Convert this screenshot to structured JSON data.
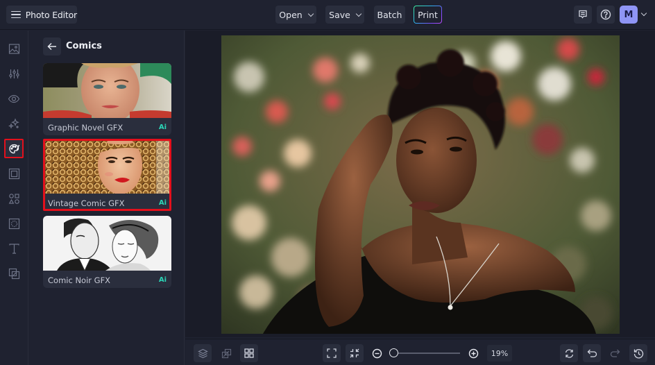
{
  "app": {
    "title": "Photo Editor"
  },
  "toolbar": {
    "open_label": "Open",
    "save_label": "Save",
    "batch_label": "Batch",
    "print_label": "Print",
    "feedback_icon": "feedback-icon",
    "help_icon": "help-icon",
    "avatar_initial": "M"
  },
  "rail": {
    "items": [
      {
        "name": "image",
        "icon": "image-icon",
        "active": false
      },
      {
        "name": "adjust",
        "icon": "sliders-icon",
        "active": false
      },
      {
        "name": "view",
        "icon": "eye-icon",
        "active": false
      },
      {
        "name": "effects",
        "icon": "sparkles-icon",
        "active": false
      },
      {
        "name": "artsy",
        "icon": "palette-icon",
        "active": true
      },
      {
        "name": "frames",
        "icon": "frame-icon",
        "active": false
      },
      {
        "name": "graphics",
        "icon": "shapes-icon",
        "active": false
      },
      {
        "name": "textures",
        "icon": "texture-icon",
        "active": false
      },
      {
        "name": "text",
        "icon": "text-icon",
        "active": false
      },
      {
        "name": "overlays",
        "icon": "overlay-icon",
        "active": false
      }
    ]
  },
  "panel": {
    "title": "Comics",
    "back_icon": "arrow-left-icon",
    "cards": [
      {
        "label": "Graphic Novel GFX",
        "badge": "Ai",
        "selected": false
      },
      {
        "label": "Vintage Comic GFX",
        "badge": "Ai",
        "selected": true
      },
      {
        "label": "Comic Noir GFX",
        "badge": "Ai",
        "selected": false
      }
    ]
  },
  "bottombar": {
    "zoom_value": "19%",
    "zoom_fraction": 0.0
  },
  "colors": {
    "background": "#1f2230",
    "surface": "#2a2e3d",
    "selection": "#e3101c",
    "ai_badge": "#2bd5b7",
    "avatar": "#8f95f5"
  }
}
